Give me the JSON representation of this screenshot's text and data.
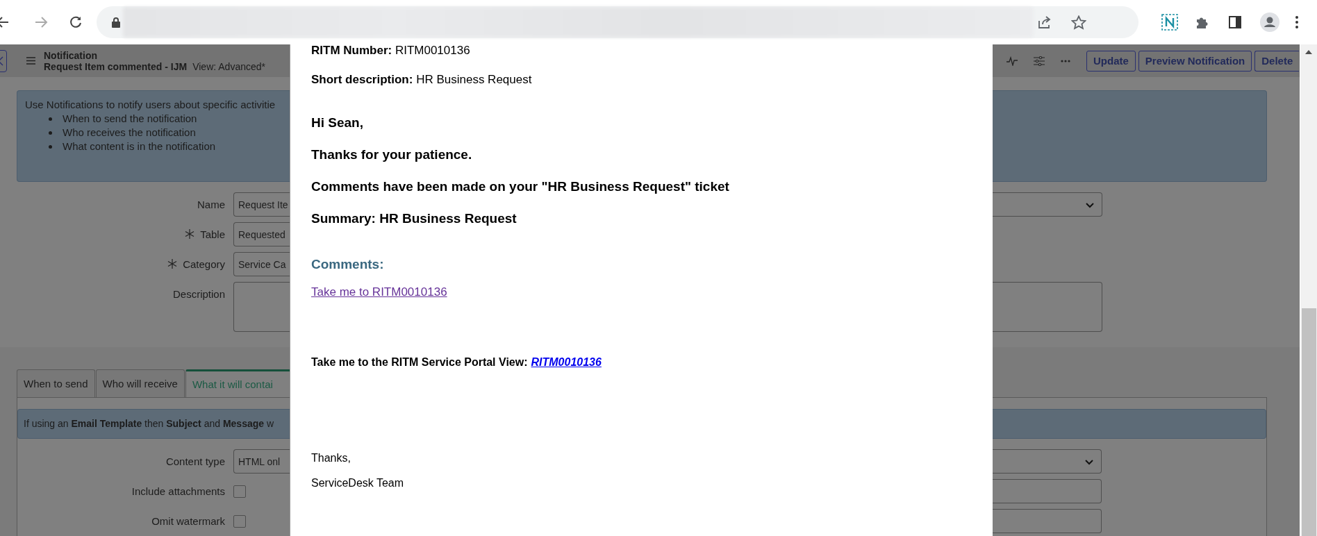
{
  "header": {
    "title": "Notification",
    "subtitle": "Request Item commented - IJM",
    "view": "View: Advanced*",
    "buttons": [
      "Update",
      "Preview Notification",
      "Delete"
    ]
  },
  "info": {
    "intro": "Use Notifications to notify users about specific activitie",
    "bullets": [
      "When to send the notification",
      "Who receives the notification",
      "What content is in the notification"
    ]
  },
  "fields": [
    {
      "label": "Name",
      "value": "Request Ite",
      "required": false,
      "kind": "select"
    },
    {
      "label": "Table",
      "value": "Requested",
      "required": true,
      "kind": "short"
    },
    {
      "label": "Category",
      "value": "Service Ca",
      "required": true,
      "kind": "short"
    },
    {
      "label": "Description",
      "required": false,
      "kind": "textarea"
    }
  ],
  "tabs": [
    {
      "label": "When to send",
      "selected": false
    },
    {
      "label": "Who will receive",
      "selected": false
    },
    {
      "label": "What it will contai",
      "selected": true
    }
  ],
  "notice": "If using an **Email Template** then **Subject** and **Message** w",
  "content_fields": [
    {
      "label": "Content type",
      "kind": "select",
      "value": "HTML onl"
    },
    {
      "label": "Include attachments",
      "kind": "checkbox",
      "checked": false
    },
    {
      "label": "Omit watermark",
      "kind": "checkbox",
      "checked": false
    }
  ],
  "email": [
    {
      "kind": "meta",
      "text": "**RITM Number:** RITM0010136"
    },
    {
      "kind": "meta",
      "text": "**Short description:** HR Business Request"
    },
    {
      "kind": "greeting",
      "text": "Hi Sean,"
    },
    {
      "kind": "greeting",
      "text": "Thanks for your patience."
    },
    {
      "kind": "greeting",
      "text": "Comments have been made on your \"HR Business Request\" ticket"
    },
    {
      "kind": "greeting",
      "text": "Summary: HR Business Request"
    },
    {
      "kind": "heading",
      "text": "Comments:"
    },
    {
      "kind": "link",
      "text": "Take me to RITM0010136"
    },
    {
      "kind": "portal",
      "text": "Take me to the RITM Service Portal View:",
      "link": "RITM0010136"
    },
    {
      "kind": "signoff",
      "text": "Thanks,"
    },
    {
      "kind": "signoff",
      "text": "ServiceDesk Team"
    }
  ]
}
